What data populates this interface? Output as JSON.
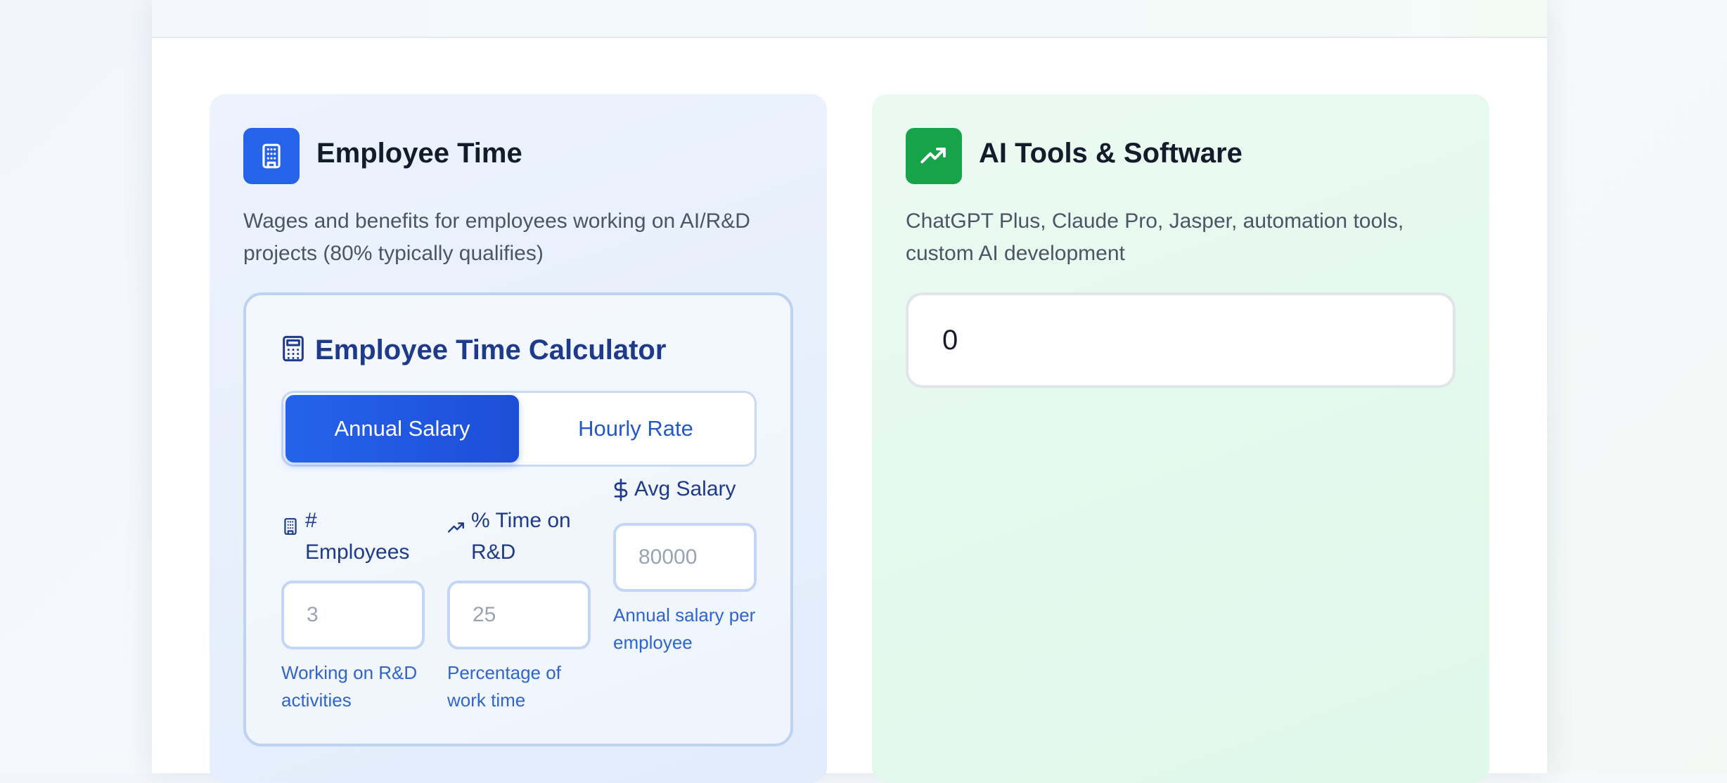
{
  "employee_card": {
    "title": "Employee Time",
    "icon": "building-icon",
    "description": "Wages and benefits for employees working on AI/R&D projects (80% typically qualifies)",
    "accent_color": "#2563eb",
    "calculator": {
      "title": "Employee Time Calculator",
      "icon": "calculator-icon",
      "modes": [
        {
          "label": "Annual Salary",
          "active": true
        },
        {
          "label": "Hourly Rate",
          "active": false
        }
      ],
      "fields": [
        {
          "label": "# Employees",
          "icon": "building-icon",
          "placeholder": "3",
          "hint": "Working on R&D activities"
        },
        {
          "label": "% Time on R&D",
          "icon": "trending-up-icon",
          "placeholder": "25",
          "hint": "Percentage of work time"
        },
        {
          "label": "Avg Salary",
          "icon": "dollar-icon",
          "placeholder": "80000",
          "hint": "Annual salary per employee"
        }
      ]
    }
  },
  "ai_card": {
    "title": "AI Tools & Software",
    "icon": "trending-up-icon",
    "description": "ChatGPT Plus, Claude Pro, Jasper, automation tools, custom AI development",
    "accent_color": "#16a34a",
    "input_value": "0"
  }
}
